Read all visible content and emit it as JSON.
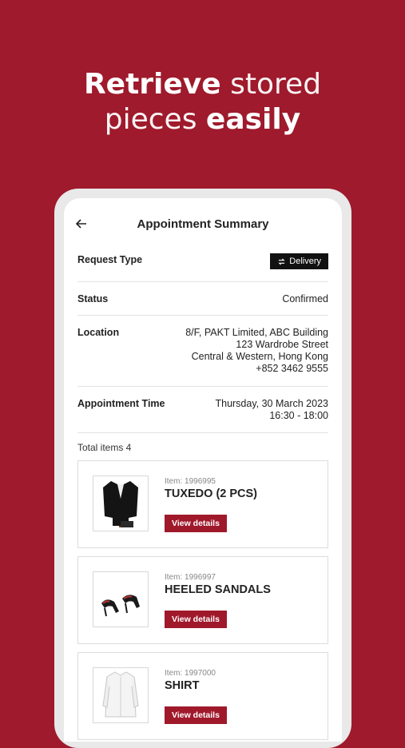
{
  "headline": {
    "line1_strong": "Retrieve",
    "line1_light": "stored",
    "line2_light": "pieces",
    "line2_strong": "easily"
  },
  "nav": {
    "back_icon": "arrow-left-icon",
    "title": "Appointment Summary"
  },
  "summary": {
    "request_type_label": "Request Type",
    "request_type_value": "Delivery",
    "request_type_icon": "swap-icon",
    "status_label": "Status",
    "status_value": "Confirmed",
    "location_label": "Location",
    "location_lines": [
      "8/F, PAKT Limited, ABC Building",
      "123 Wardrobe Street",
      "Central & Western, Hong Kong",
      "+852 3462 9555"
    ],
    "appointment_time_label": "Appointment Time",
    "appointment_date": "Thursday, 30 March 2023",
    "appointment_slot": "16:30 - 18:00"
  },
  "items": {
    "total_label": "Total items 4",
    "list": [
      {
        "item_no": "Item: 1996995",
        "name": "TUXEDO (2 PCS)",
        "button": "View details",
        "icon": "tuxedo-image"
      },
      {
        "item_no": "Item: 1996997",
        "name": "HEELED SANDALS",
        "button": "View details",
        "icon": "sandals-image"
      },
      {
        "item_no": "Item: 1997000",
        "name": "SHIRT",
        "button": "View details",
        "icon": "shirt-image"
      }
    ]
  },
  "colors": {
    "brand": "#9e1a2c",
    "button": "#a0192b",
    "badge": "#111111"
  }
}
